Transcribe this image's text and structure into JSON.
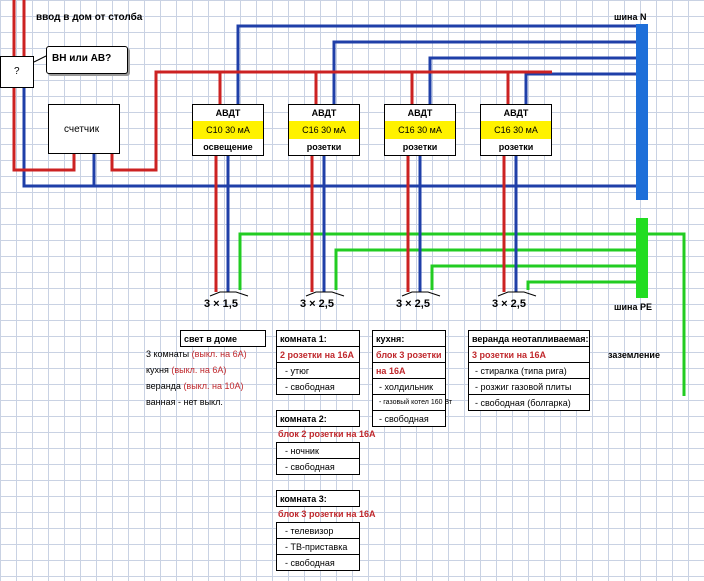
{
  "header": {
    "title": "ввод в дом от столба"
  },
  "question": {
    "mark": "?",
    "callout": "ВН или АВ?"
  },
  "meter": {
    "label": "счетчик"
  },
  "breakers": [
    {
      "title": "АВДТ",
      "rating": "С10 30 мА",
      "purpose": "освещение",
      "cable": "3 × 1,5"
    },
    {
      "title": "АВДТ",
      "rating": "С16 30 мА",
      "purpose": "розетки",
      "cable": "3 × 2,5"
    },
    {
      "title": "АВДТ",
      "rating": "С16 30 мА",
      "purpose": "розетки",
      "cable": "3 × 2,5"
    },
    {
      "title": "АВДТ",
      "rating": "С16 30 мА",
      "purpose": "розетки",
      "cable": "3 × 2,5"
    }
  ],
  "buses": {
    "neutral": "шина N",
    "earth": "шина PE",
    "grounding": "заземление"
  },
  "lighting": {
    "header": "свет в доме",
    "rows": [
      {
        "text": "3 комнаты ",
        "note": "(выкл. на 6А)"
      },
      {
        "text": "кухня ",
        "note": "(выкл. на 6А)"
      },
      {
        "text": "веранда ",
        "note": "(выкл. на 10А)"
      },
      {
        "text": "ванная - нет выкл.",
        "note": ""
      }
    ]
  },
  "room1": {
    "header": "комната 1:",
    "spec": "2 розетки на 16А",
    "items": [
      "- утюг",
      "- свободная"
    ]
  },
  "room2": {
    "header": "комната 2:",
    "spec": "блок 2 розетки на 16А",
    "items": [
      "- ночник",
      "- свободная"
    ]
  },
  "room3": {
    "header": "комната 3:",
    "spec": "блок 3 розетки на 16А",
    "items": [
      "- телевизор",
      "- ТВ-приставка",
      "- свободная"
    ]
  },
  "kitchen": {
    "header": "кухня:",
    "spec1": "блок 3 розетки",
    "spec2": "на 16А",
    "items": [
      "- холдильник",
      "- газовый котел 160 Вт",
      "- свободная"
    ]
  },
  "veranda": {
    "header": "веранда неотапливаемая:",
    "spec": "3 розетки на 16А",
    "items": [
      "- стиралка (типа рига)",
      "- розжиг газовой плиты",
      "- свободная (болгарка)"
    ]
  },
  "colors": {
    "phase": "#cc2222",
    "neutral": "#1f3fa8",
    "earth": "#22cc22",
    "bus_n": "#1e6fd9",
    "bus_pe": "#22dd22",
    "breaker_rating_bg": "#fff200"
  }
}
